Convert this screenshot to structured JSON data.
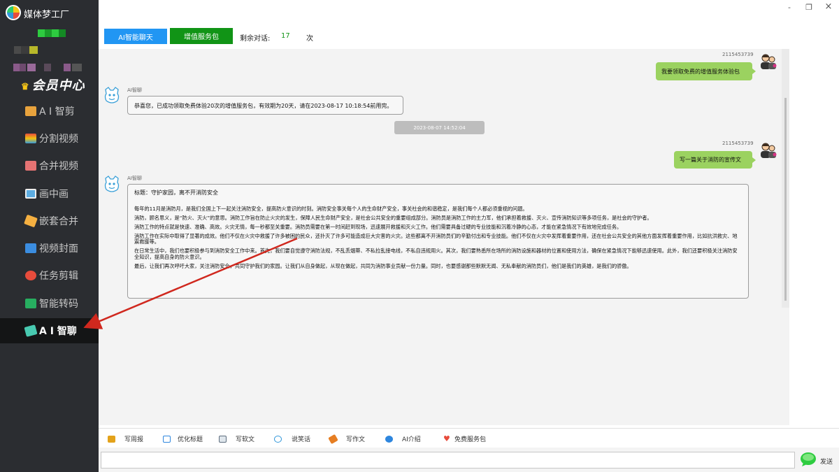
{
  "app": {
    "title": "媒体梦工厂",
    "member_center": "会员中心",
    "member_center_icon": "crown-icon"
  },
  "window_controls": {
    "minimize": "-",
    "restore": "❐",
    "close": "×"
  },
  "nav": [
    {
      "label": "A I 智剪",
      "icon": "ai-cut-icon",
      "color": "#e8a33d"
    },
    {
      "label": "分割视频",
      "icon": "split-video-icon",
      "color": "#e74c3c"
    },
    {
      "label": "合并视频",
      "icon": "merge-video-icon",
      "color": "#e57373"
    },
    {
      "label": "画中画",
      "icon": "picture-in-picture-icon",
      "color": "#5dade2"
    },
    {
      "label": "嵌套合并",
      "icon": "nested-merge-icon",
      "color": "#f5b041"
    },
    {
      "label": "视频封面",
      "icon": "video-cover-icon",
      "color": "#3b8de0"
    },
    {
      "label": "任务剪辑",
      "icon": "task-edit-icon",
      "color": "#e74c3c"
    },
    {
      "label": "智能转码",
      "icon": "smart-transcode-icon",
      "color": "#27ae60"
    },
    {
      "label": "A I 智聊",
      "icon": "ai-chat-icon",
      "color": "#48c9b0",
      "active": true
    }
  ],
  "toolbar": {
    "ai_chat_button": "AI智能聊天",
    "vas_button": "增值服务包",
    "remaining_label": "剩余对话:",
    "remaining_count": "17",
    "remaining_unit": "次"
  },
  "chat": {
    "messages": {
      "user1": {
        "user_id": "2115453739",
        "text": "我要领取免费的增值服务体验包"
      },
      "ai1": {
        "name": "AI智聊",
        "text": "恭喜您，已成功领取免费体验20次的增值服务包，有效期为20天，请在2023-08-17 10:18:54前用完。"
      },
      "timestamp": "2023-08-07 14:52:04",
      "user2": {
        "user_id": "2115453739",
        "text": "写一篇关于消防的宣传文"
      },
      "ai2": {
        "name": "AI智聊",
        "paragraphs": [
          "标题：守护家园，离不开消防安全",
          "每年的11月是消防月，是我们全国上下一起关注消防安全，提高防火意识的时刻。消防安全事关每个人的生命财产安全，事关社会的和谐稳定，是我们每个人都必须重视的问题。",
          "消防，顾名思义，是“防火、灭火”的意思。消防工作旨在防止火灾的发生，保障人民生命财产安全，是社会公共安全的重要组成部分。消防员是消防工作的主力军，他们承担着救援、灭火、宣传消防知识等多项任务，是社会的守护者。",
          "消防工作的特点就是快速、准确、高效。火灾无情，每一秒都至关重要。消防员需要在第一时间赶到现场，迅速展开救援和灭火工作。他们需要具备过硬的专业技能和沉着冷静的心态，才能在紧急情况下有效地完成任务。",
          "消防工作在实际中取得了显著的成效。他们不仅在火灾中救援了许多被困的民众，还扑灭了许多可能造成巨大灾害的火灾。这些都离不开消防员们的辛勤付出和专业技能。他们不仅在火灾中发挥着重要作用，还在社会公共安全的其他方面发挥着重要作用，比如抗洪救灾、地震救援等。",
          "在日常生活中，我们也要积极参与到消防安全工作中来。首先，我们要自觉遵守消防法规，不乱丢烟蒂、不私拉乱接电线，不私自违规用火。其次，我们要熟悉所在场所的消防设施和器材的位置和使用方法，确保在紧急情况下能够迅速使用。此外，我们还要积极关注消防安全知识，提高自身的防火意识。",
          "最后，让我们再次呼吁大家，关注消防安全，共同守护我们的家园。让我们从自身做起，从现在做起，共同为消防事业贡献一份力量。同时，也要感谢那些默默无闻、无私奉献的消防员们，他们是我们的英雄，是我们的骄傲。"
        ]
      }
    }
  },
  "tools": [
    {
      "label": "写周报",
      "icon": "weekly-report-icon",
      "color": "#e3a21a"
    },
    {
      "label": "优化标题",
      "icon": "optimize-title-icon",
      "color": "#2e86de"
    },
    {
      "label": "写软文",
      "icon": "soft-article-icon",
      "color": "#5d6d7e"
    },
    {
      "label": "说笑话",
      "icon": "joke-icon",
      "color": "#3498db"
    },
    {
      "label": "写作文",
      "icon": "essay-icon",
      "color": "#e67e22"
    },
    {
      "label": "AI介绍",
      "icon": "info-icon",
      "color": "#2e86de"
    },
    {
      "label": "免费服务包",
      "icon": "heart-icon",
      "color": "#e74c3c"
    }
  ],
  "input": {
    "placeholder": "",
    "send_label": "发送",
    "send_icon": "speech-bubble-icon"
  },
  "colors": {
    "sidebar": "#2b2d31",
    "accent_blue": "#2196f3",
    "accent_green": "#119416",
    "user_bubble": "#9bd260",
    "arrow": "#d0281e"
  }
}
